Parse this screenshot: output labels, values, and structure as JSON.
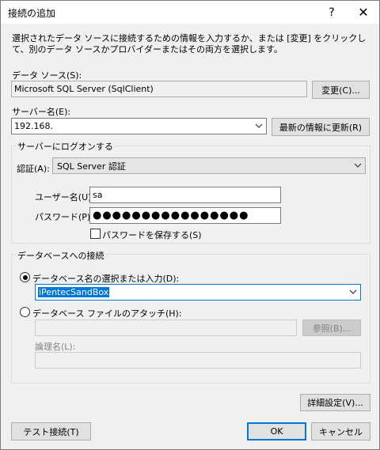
{
  "window": {
    "title": "接続の追加",
    "help_glyph": "?",
    "close_glyph": "✕"
  },
  "description": "選択されたデータ ソースに接続するための情報を入力するか、または [変更] をクリックして、別のデータ ソースかプロバイダーまたはその両方を選択します。",
  "data_source": {
    "label": "データ ソース(S):",
    "value": "Microsoft SQL Server (SqlClient)",
    "change_button": "変更(C)..."
  },
  "server": {
    "label": "サーバー名(E):",
    "value": "192.168.",
    "refresh_button": "最新の情報に更新(R)"
  },
  "logon": {
    "group_title": "サーバーにログオンする",
    "auth_label": "認証(A):",
    "auth_value": "SQL Server 認証",
    "user_label": "ユーザー名(U):",
    "user_value": "sa",
    "password_label": "パスワード(P):",
    "password_value": "●●●●●●●●●●●●●●●●",
    "save_password_label": "パスワードを保存する(S)",
    "save_password_checked": false
  },
  "database": {
    "group_title": "データベースへの接続",
    "select_option_label": "データベース名の選択または入力(D):",
    "select_option_checked": true,
    "db_name_value": "iPentecSandBox",
    "attach_option_label": "データベース ファイルのアタッチ(H):",
    "attach_option_checked": false,
    "browse_button": "参照(B)...",
    "logical_name_label": "論理名(L):"
  },
  "advanced_button": "詳細設定(V)...",
  "test_button": "テスト接続(T)",
  "ok_button": "OK",
  "cancel_button": "キャンセル",
  "icons": {
    "chevron": "chevron-down-icon"
  }
}
